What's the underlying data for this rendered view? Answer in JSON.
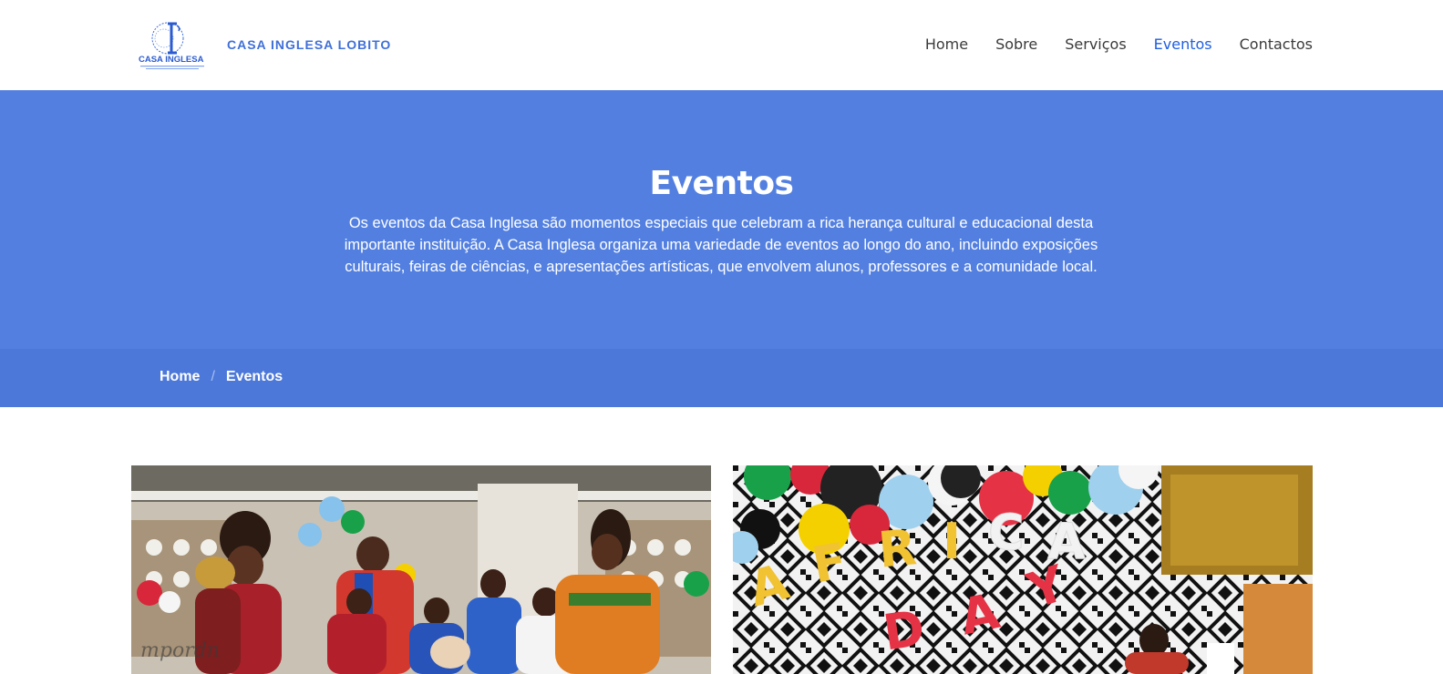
{
  "header": {
    "brand": "CASA INGLESA LOBITO",
    "logo_text": "CASA INGLESA",
    "nav": [
      {
        "label": "Home",
        "active": false
      },
      {
        "label": "Sobre",
        "active": false
      },
      {
        "label": "Serviços",
        "active": false
      },
      {
        "label": "Eventos",
        "active": true
      },
      {
        "label": "Contactos",
        "active": false
      }
    ]
  },
  "hero": {
    "title": "Eventos",
    "description": "Os eventos da Casa Inglesa são momentos especiais que celebram a rica herança cultural e educacional desta importante instituição. A Casa Inglesa organiza uma variedade de eventos ao longo do ano, incluindo exposições culturais, feiras de ciências, e apresentações artísticas, que envolvem alunos, professores e a comunidade local."
  },
  "breadcrumb": {
    "home": "Home",
    "current": "Eventos"
  },
  "events": {
    "card1_caption": "",
    "card2_letters": [
      "A",
      "F",
      "R",
      "I",
      "C",
      "A",
      "D",
      "A",
      "Y"
    ]
  },
  "colors": {
    "accent": "#5380e0",
    "breadcrumb_bg": "#4c78da",
    "nav_active": "#1f5fe0",
    "brand": "#3f6fd8"
  }
}
